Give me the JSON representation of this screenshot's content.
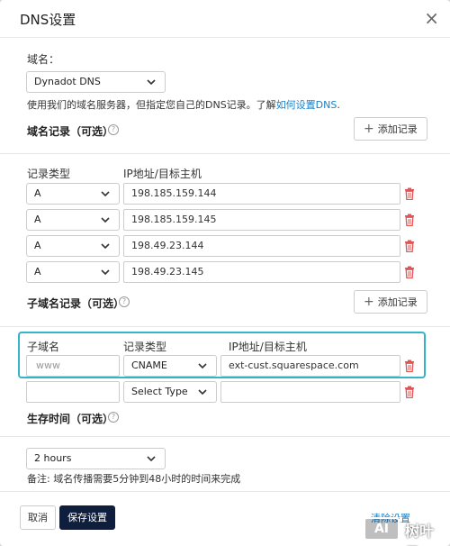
{
  "dialog": {
    "title": "DNS设置",
    "close_symbol": "×"
  },
  "domain": {
    "label": "域名：",
    "selected": "Dynadot DNS",
    "hint_prefix": "使用我们的域名服务器，但指定您自己的DNS记录。了解",
    "hint_link": "如何设置DNS",
    "hint_suffix": "."
  },
  "records": {
    "title": "域名记录（可选）",
    "help_symbol": "?",
    "add_label": "添加记录",
    "col_type": "记录类型",
    "col_ip": "IP地址/目标主机",
    "rows": [
      {
        "type": "A",
        "value": "198.185.159.144"
      },
      {
        "type": "A",
        "value": "198.185.159.145"
      },
      {
        "type": "A",
        "value": "198.49.23.144"
      },
      {
        "type": "A",
        "value": "198.49.23.145"
      }
    ]
  },
  "subdomains": {
    "title": "子域名记录（可选）",
    "help_symbol": "?",
    "add_label": "添加记录",
    "col_sub": "子域名",
    "col_type": "记录类型",
    "col_ip": "IP地址/目标主机",
    "rows": [
      {
        "sub": "www",
        "type": "CNAME",
        "value": "ext-cust.squarespace.com"
      },
      {
        "sub": "",
        "type": "Select Type",
        "value": ""
      }
    ]
  },
  "ttl": {
    "title": "生存时间（可选）",
    "help_symbol": "?",
    "selected": "2 hours",
    "note": "备注: 域名传播需要5分钟到48小时的时间来完成"
  },
  "footer": {
    "cancel_label": "取消",
    "save_label": "保存设置",
    "partial_link": "清除设置"
  },
  "watermark": {
    "logo": "AI",
    "text": "树叶云"
  },
  "colors": {
    "accent": "#35b3c9",
    "primary": "#0f1e3d",
    "link": "#1a7fc3",
    "danger": "#e05555"
  }
}
